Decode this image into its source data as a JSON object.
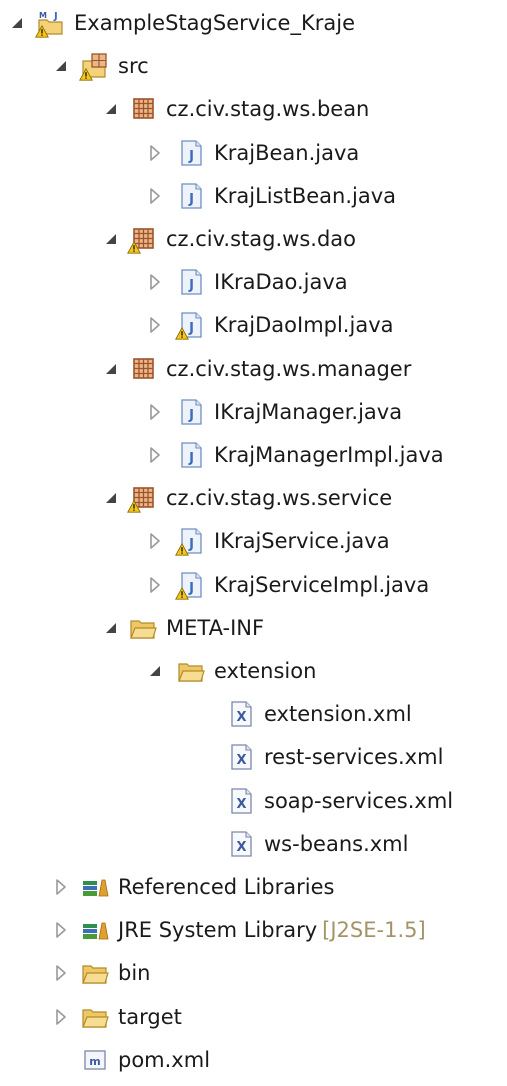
{
  "icons": {
    "expanded": "expanded-triangle-icon",
    "collapsed": "collapsed-triangle-icon",
    "maven_project": "maven-project-icon",
    "package_folder": "source-package-icon",
    "package": "package-icon",
    "java_file": "java-file-icon",
    "xml_file": "xml-file-icon",
    "folder": "folder-icon",
    "library": "library-icon",
    "pom": "maven-pom-icon"
  },
  "colors": {
    "package_brown": "#a0522d",
    "java_blue": "#3b6dbb",
    "folder_yellow": "#f3d27a",
    "warning_yellow": "#f5c518",
    "tag_gray": "#a39468"
  },
  "tree": [
    {
      "label": "ExampleStagService_Kraje",
      "depth": 0,
      "state": "expanded",
      "icon": "maven-project-icon",
      "warning": true
    },
    {
      "label": "src",
      "depth": 1,
      "state": "expanded",
      "icon": "source-package-icon",
      "warning": true
    },
    {
      "label": "cz.civ.stag.ws.bean",
      "depth": 2,
      "state": "expanded",
      "icon": "package-icon",
      "warning": false
    },
    {
      "label": "KrajBean.java",
      "depth": 3,
      "state": "collapsed",
      "icon": "java-file-icon",
      "warning": false
    },
    {
      "label": "KrajListBean.java",
      "depth": 3,
      "state": "collapsed",
      "icon": "java-file-icon",
      "warning": false
    },
    {
      "label": "cz.civ.stag.ws.dao",
      "depth": 2,
      "state": "expanded",
      "icon": "package-icon",
      "warning": true
    },
    {
      "label": "IKraDao.java",
      "depth": 3,
      "state": "collapsed",
      "icon": "java-file-icon",
      "warning": false
    },
    {
      "label": "KrajDaoImpl.java",
      "depth": 3,
      "state": "collapsed",
      "icon": "java-file-icon",
      "warning": true
    },
    {
      "label": "cz.civ.stag.ws.manager",
      "depth": 2,
      "state": "expanded",
      "icon": "package-icon",
      "warning": false
    },
    {
      "label": "IKrajManager.java",
      "depth": 3,
      "state": "collapsed",
      "icon": "java-file-icon",
      "warning": false
    },
    {
      "label": "KrajManagerImpl.java",
      "depth": 3,
      "state": "collapsed",
      "icon": "java-file-icon",
      "warning": false
    },
    {
      "label": "cz.civ.stag.ws.service",
      "depth": 2,
      "state": "expanded",
      "icon": "package-icon",
      "warning": true
    },
    {
      "label": "IKrajService.java",
      "depth": 3,
      "state": "collapsed",
      "icon": "java-file-icon",
      "warning": true
    },
    {
      "label": "KrajServiceImpl.java",
      "depth": 3,
      "state": "collapsed",
      "icon": "java-file-icon",
      "warning": true
    },
    {
      "label": "META-INF",
      "depth": 2,
      "state": "expanded",
      "icon": "folder-icon",
      "warning": false
    },
    {
      "label": "extension",
      "depth": 3,
      "state": "expanded",
      "icon": "folder-icon",
      "warning": false
    },
    {
      "label": "extension.xml",
      "depth": 4,
      "state": "leaf",
      "icon": "xml-file-icon",
      "warning": false
    },
    {
      "label": "rest-services.xml",
      "depth": 4,
      "state": "leaf",
      "icon": "xml-file-icon",
      "warning": false
    },
    {
      "label": "soap-services.xml",
      "depth": 4,
      "state": "leaf",
      "icon": "xml-file-icon",
      "warning": false
    },
    {
      "label": "ws-beans.xml",
      "depth": 4,
      "state": "leaf",
      "icon": "xml-file-icon",
      "warning": false
    },
    {
      "label": "Referenced Libraries",
      "depth": 1,
      "state": "collapsed",
      "icon": "library-icon",
      "warning": false
    },
    {
      "label": "JRE System Library",
      "tag": "[J2SE-1.5]",
      "depth": 1,
      "state": "collapsed",
      "icon": "library-icon",
      "warning": false
    },
    {
      "label": "bin",
      "depth": 1,
      "state": "collapsed",
      "icon": "folder-icon",
      "warning": false
    },
    {
      "label": "target",
      "depth": 1,
      "state": "collapsed",
      "icon": "folder-icon",
      "warning": false
    },
    {
      "label": "pom.xml",
      "depth": 1,
      "state": "leaf",
      "icon": "maven-pom-icon",
      "warning": false
    }
  ]
}
